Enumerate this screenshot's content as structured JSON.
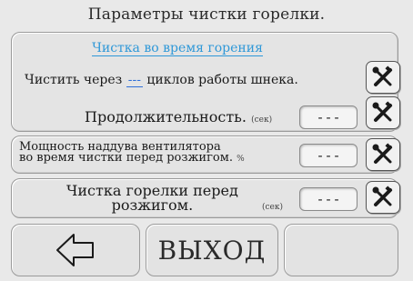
{
  "header": {
    "title": "Параметры чистки горелки."
  },
  "burning_section": {
    "subtitle": "Чистка во время горения",
    "clean_every_prefix": "Чистить через",
    "clean_every_value": "---",
    "clean_every_suffix": "циклов работы шнека.",
    "duration_label": "Продолжительность.",
    "duration_unit": "(сек)",
    "duration_value": "---"
  },
  "fan_section": {
    "label_line1": "Мощность наддува вентилятора",
    "label_line2": "во время чистки перед розжигом.",
    "unit": "%",
    "value": "---"
  },
  "preignition_section": {
    "label_line1": "Чистка горелки перед",
    "label_line2": "розжигом.",
    "unit": "(сек)",
    "value": "---"
  },
  "footer": {
    "back_icon": "arrow-left-icon",
    "exit_label": "ВЫХОД"
  },
  "icons": {
    "settings": "wrench-screwdriver-icon"
  }
}
